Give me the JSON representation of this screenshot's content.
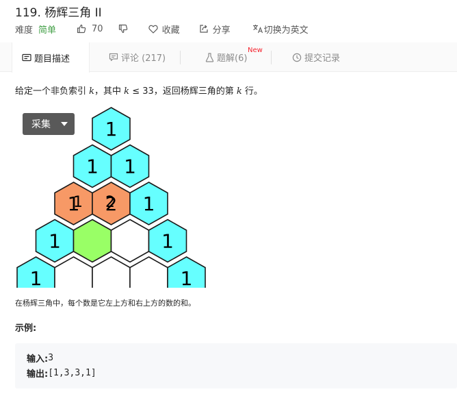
{
  "problem": {
    "title": "119. 杨辉三角 II",
    "difficulty_label": "难度",
    "difficulty_value": "简单",
    "likes": "70",
    "favorite_label": "收藏",
    "share_label": "分享",
    "translate_label": "切换为英文"
  },
  "tabs": [
    {
      "label": "题目描述",
      "icon": "description-icon",
      "active": true
    },
    {
      "label": "评论 (217)",
      "icon": "comment-icon",
      "active": false
    },
    {
      "label": "题解(6)",
      "icon": "flask-icon",
      "active": false,
      "badge": "New"
    },
    {
      "label": "提交记录",
      "icon": "clock-icon",
      "active": false
    }
  ],
  "description": {
    "part1": "给定一个非负索引 ",
    "var1": "k",
    "part2": "，其中 ",
    "var2": "k",
    "part3": " ≤ 33，返回杨辉三角的第 ",
    "var3": "k",
    "part4": " 行。"
  },
  "collect_button": "采集",
  "triangle": {
    "rows": [
      [
        "1"
      ],
      [
        "1",
        "1"
      ],
      [
        "1",
        "2",
        "1"
      ],
      [
        "1",
        "",
        "",
        "1"
      ],
      [
        "1",
        "",
        "",
        "",
        "1"
      ]
    ],
    "ghost_labels": [
      "1",
      "2"
    ],
    "colors": {
      "cyan": "#66ffff",
      "orange": "#f79966",
      "green": "#99ff66",
      "white": "#ffffff"
    }
  },
  "caption": "在杨辉三角中，每个数是它左上方和右上方的数的和。",
  "example": {
    "label": "示例:",
    "input_key": "输入:",
    "input_value": " 3",
    "output_key": "输出:",
    "output_value": " [1,3,3,1]"
  },
  "colors": {
    "accent_green": "#43a047",
    "badge_red": "#f5222d",
    "tab_bg": "#fafafa",
    "code_bg": "#f7f8fa"
  }
}
